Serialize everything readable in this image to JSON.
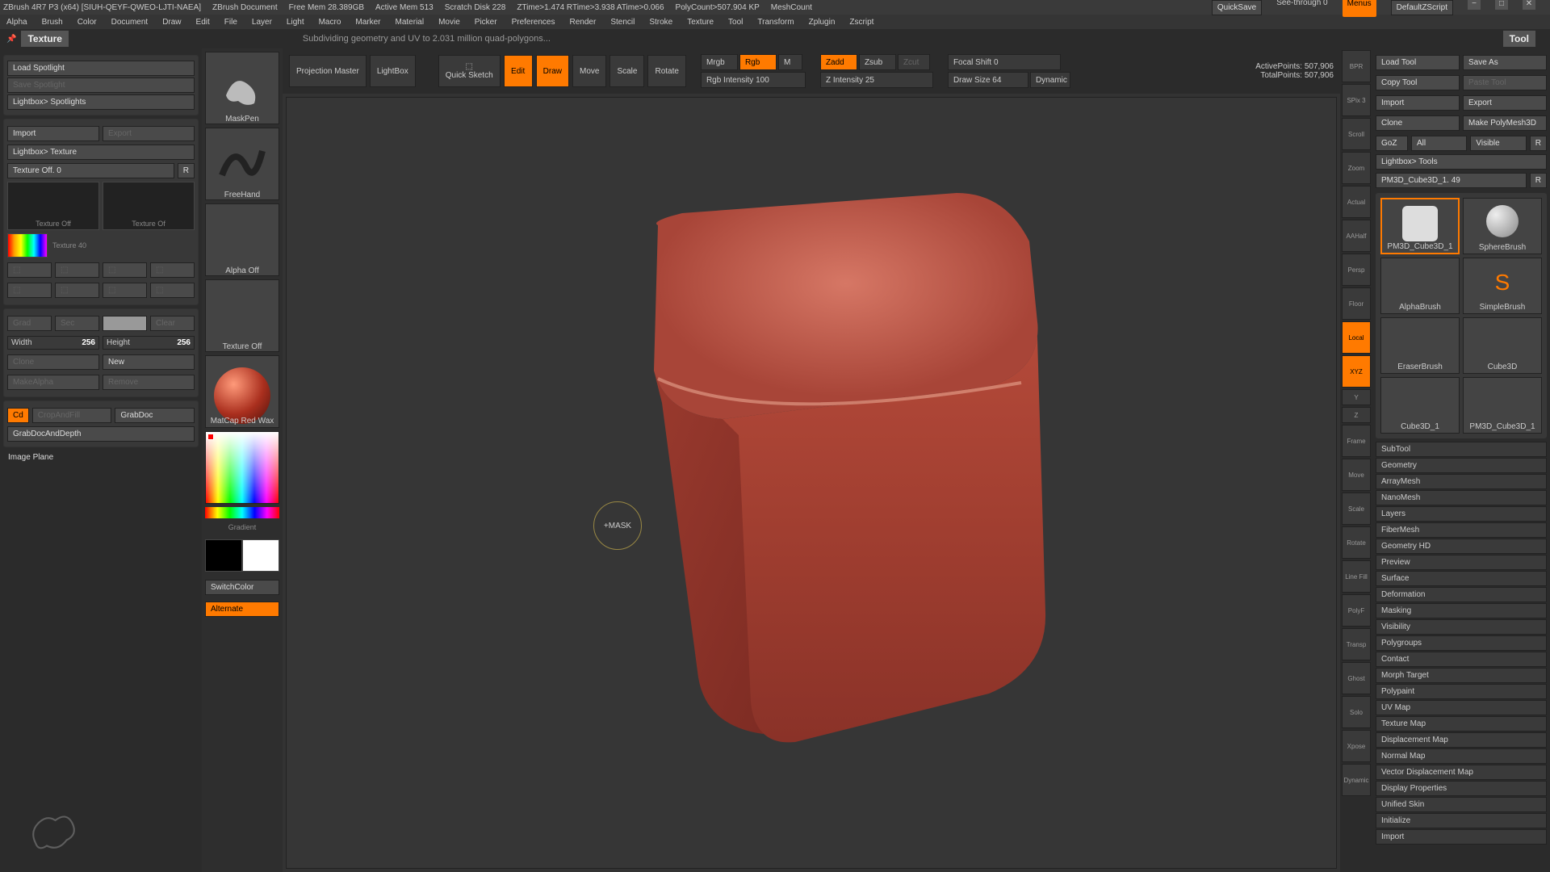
{
  "titlebar": {
    "app": "ZBrush 4R7 P3 (x64) [SIUH-QEYF-QWEO-LJTI-NAEA]",
    "doc": "ZBrush Document",
    "stats": [
      "Free Mem 28.389GB",
      "Active Mem 513",
      "Scratch Disk 228",
      "ZTime>1.474 RTime>3.938 ATime>0.066",
      "PolyCount>507.904 KP",
      "MeshCount"
    ],
    "quicksave": "QuickSave",
    "seethrough": "See-through  0",
    "menus": "Menus",
    "script": "DefaultZScript"
  },
  "menubar": [
    "Alpha",
    "Brush",
    "Color",
    "Document",
    "Draw",
    "Edit",
    "File",
    "Layer",
    "Light",
    "Macro",
    "Marker",
    "Material",
    "Movie",
    "Picker",
    "Preferences",
    "Render",
    "Stencil",
    "Stroke",
    "Texture",
    "Tool",
    "Transform",
    "Zplugin",
    "Zscript"
  ],
  "subheader": {
    "panel": "Texture",
    "msg": "Subdividing geometry and UV to 2.031 million quad-polygons..."
  },
  "left": {
    "load_spotlight": "Load Spotlight",
    "save_spotlight": "Save Spotlight",
    "lightbox_spot": "Lightbox> Spotlights",
    "import": "Import",
    "export": "Export",
    "lightbox_tex": "Lightbox> Texture",
    "texture_off": "Texture Off. 0",
    "r": "R",
    "tex_off1": "Texture Off",
    "tex_off2": "Texture Of",
    "tex40": "Texture 40",
    "grad": "Grad",
    "sec": "Sec",
    "main": "",
    "clear": "Clear",
    "width": "Width",
    "width_v": "256",
    "height": "Height",
    "height_v": "256",
    "clone": "Clone",
    "new": "New",
    "makealpha": "MakeAlpha",
    "remove": "Remove",
    "cd": "Cd",
    "cropfill": "CropAndFill",
    "grabdoc": "GrabDoc",
    "grabdocdepth": "GrabDocAndDepth",
    "imageplane": "Image Plane"
  },
  "strip": {
    "maskpen": "MaskPen",
    "freehand": "FreeHand",
    "alpha_off": "Alpha Off",
    "texture_off": "Texture Off",
    "material": "MatCap Red Wax",
    "gradient": "Gradient",
    "switchcolor": "SwitchColor",
    "alternate": "Alternate"
  },
  "toptools": {
    "projection": "Projection Master",
    "lightbox": "LightBox",
    "quicksketch": "Quick Sketch",
    "edit": "Edit",
    "draw": "Draw",
    "move": "Move",
    "scale": "Scale",
    "rotate": "Rotate",
    "mrgb": "Mrgb",
    "rgb": "Rgb",
    "m": "M",
    "rgbint": "Rgb Intensity 100",
    "zadd": "Zadd",
    "zsub": "Zsub",
    "zcut": "Zcut",
    "zint": "Z Intensity 25",
    "focal": "Focal Shift 0",
    "drawsize": "Draw Size 64",
    "dynamic": "Dynamic",
    "active": "ActivePoints: 507,906",
    "total": "TotalPoints: 507,906"
  },
  "cursor": "+MASK",
  "righticons": [
    "BPR",
    "SPix 3",
    "Scroll",
    "Zoom",
    "Actual",
    "AAHalf",
    "Persp",
    "Floor",
    "Local",
    "XYZ",
    "Y",
    "Z",
    "Frame",
    "Move",
    "Scale",
    "Rotate",
    "Line Fill",
    "PolyF",
    "Transp",
    "Ghost",
    "Solo",
    "Xpose",
    "Dynamic"
  ],
  "rightpanel": {
    "title": "Tool",
    "load": "Load Tool",
    "saveas": "Save As",
    "copy": "Copy Tool",
    "paste": "Paste Tool",
    "import": "Import",
    "export": "Export",
    "clone": "Clone",
    "makepoly": "Make PolyMesh3D",
    "goz": "GoZ",
    "all": "All",
    "visible": "Visible",
    "r": "R",
    "lightbox": "Lightbox> Tools",
    "toolname": "PM3D_Cube3D_1. 49",
    "tools": [
      "PM3D_Cube3D_1",
      "SphereBrush",
      "AlphaBrush",
      "SimpleBrush",
      "EraserBrush",
      "Cube3D",
      "Cube3D_1",
      "PM3D_Cube3D_1"
    ],
    "sections": [
      "SubTool",
      "Geometry",
      "ArrayMesh",
      "NanoMesh",
      "Layers",
      "FiberMesh",
      "Geometry HD",
      "Preview",
      "Surface",
      "Deformation",
      "Masking",
      "Visibility",
      "Polygroups",
      "Contact",
      "Morph Target",
      "Polypaint",
      "UV Map",
      "Texture Map",
      "Displacement Map",
      "Normal Map",
      "Vector Displacement Map",
      "Display Properties",
      "Unified Skin",
      "Initialize",
      "Import"
    ]
  }
}
